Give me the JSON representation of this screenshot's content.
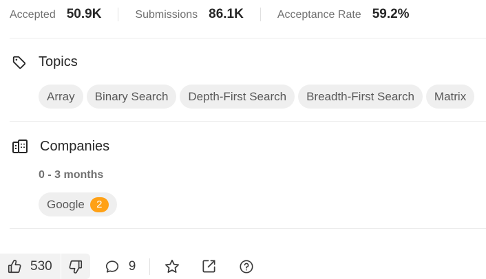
{
  "stats": {
    "accepted_label": "Accepted",
    "accepted_value": "50.9K",
    "submissions_label": "Submissions",
    "submissions_value": "86.1K",
    "rate_label": "Acceptance Rate",
    "rate_value": "59.2%"
  },
  "topics": {
    "icon": "tag-icon",
    "title": "Topics",
    "tags": [
      "Array",
      "Binary Search",
      "Depth-First Search",
      "Breadth-First Search",
      "Matrix"
    ]
  },
  "companies": {
    "icon": "building-icon",
    "title": "Companies",
    "period": "0 - 3 months",
    "items": [
      {
        "name": "Google",
        "count": "2"
      }
    ],
    "badge_color": "#ffa116"
  },
  "actions": {
    "upvote_icon": "thumbs-up-icon",
    "upvote_count": "530",
    "downvote_icon": "thumbs-down-icon",
    "comment_icon": "comment-icon",
    "comment_count": "9",
    "favorite_icon": "star-icon",
    "share_icon": "share-icon",
    "help_icon": "question-icon"
  }
}
